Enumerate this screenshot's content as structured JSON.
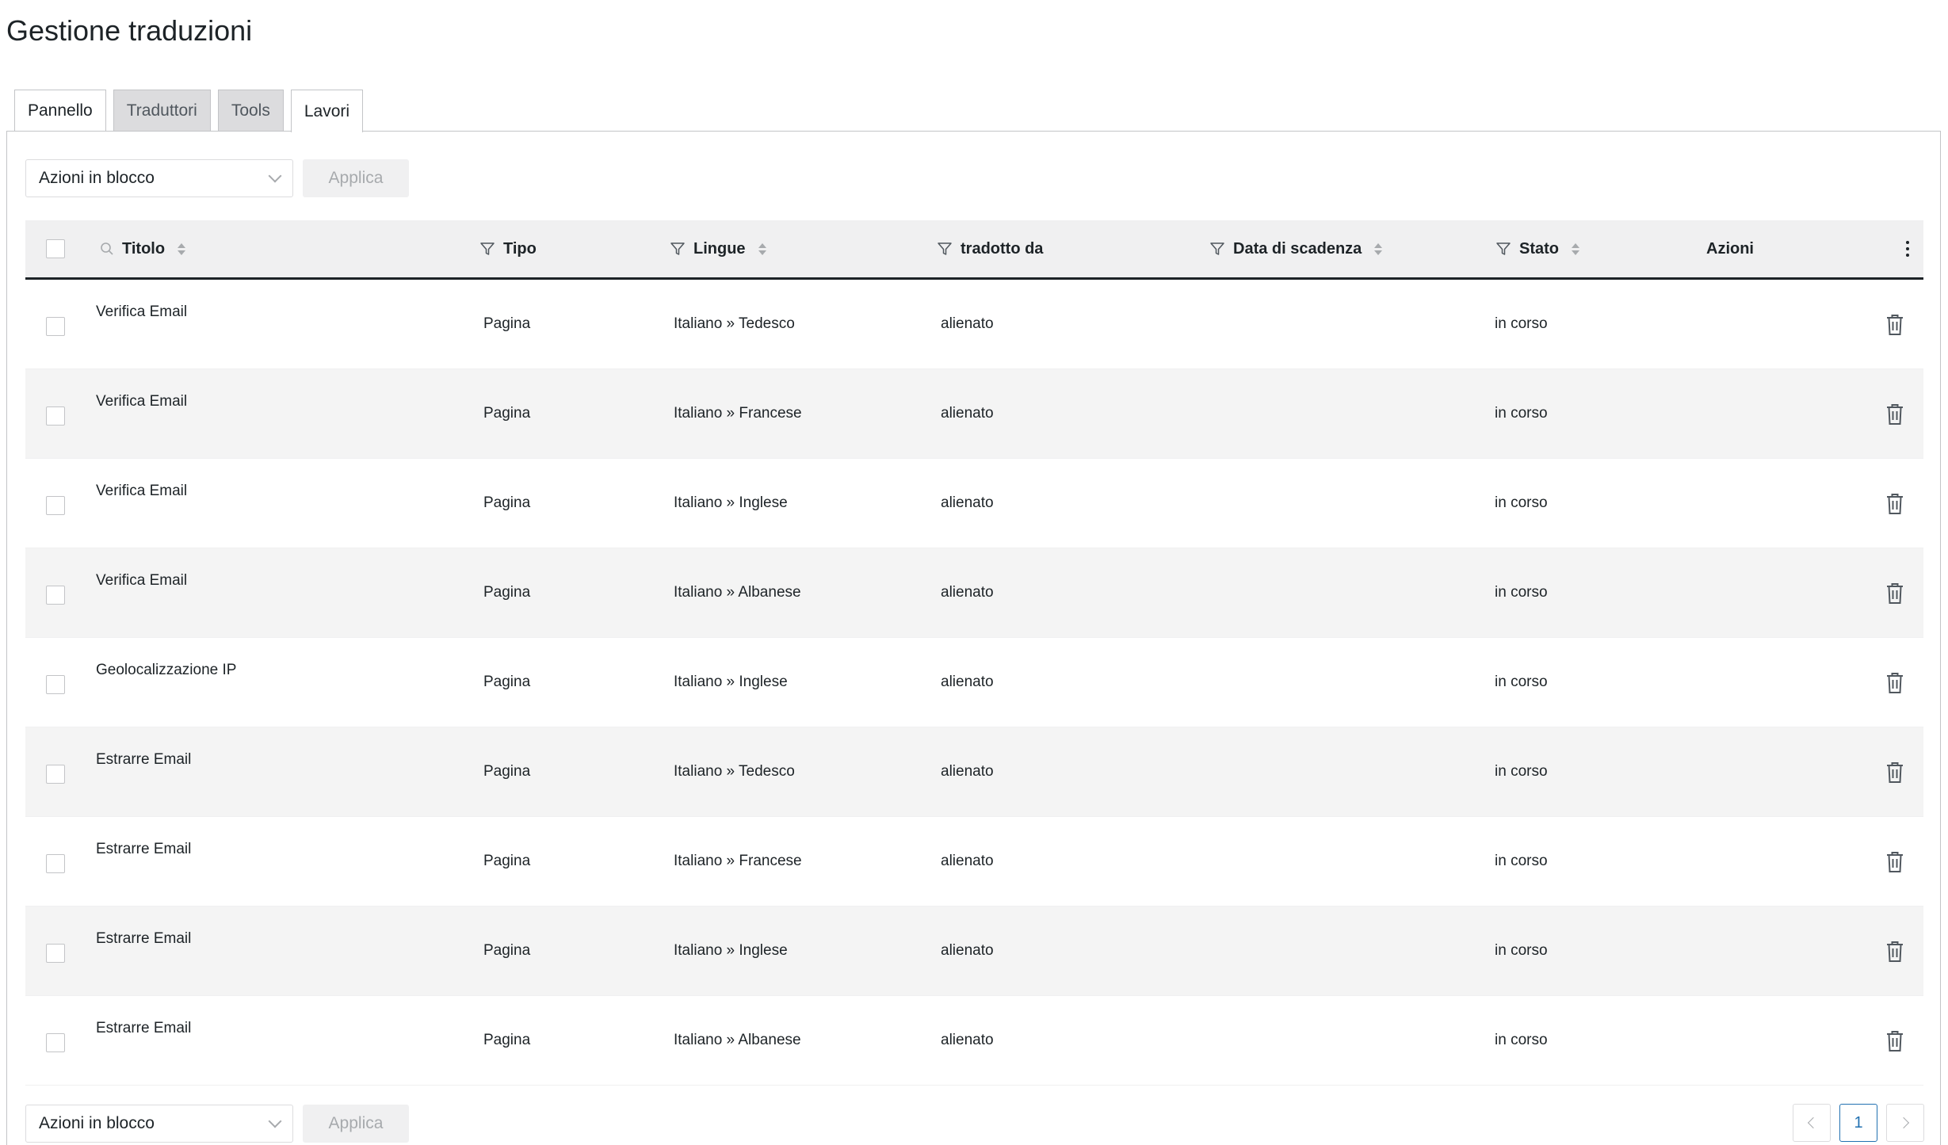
{
  "page": {
    "title": "Gestione traduzioni"
  },
  "tabs": [
    {
      "label": "Pannello",
      "state": "normal"
    },
    {
      "label": "Traduttori",
      "state": "inactive"
    },
    {
      "label": "Tools",
      "state": "inactive"
    },
    {
      "label": "Lavori",
      "state": "active"
    }
  ],
  "bulk_top": {
    "select_label": "Azioni in blocco",
    "apply_label": "Applica"
  },
  "bulk_bottom": {
    "select_label": "Azioni in blocco",
    "apply_label": "Applica"
  },
  "table": {
    "columns": {
      "title": "Titolo",
      "type": "Tipo",
      "languages": "Lingue",
      "translated_by": "tradotto da",
      "due_date": "Data di scadenza",
      "status": "Stato",
      "actions": "Azioni"
    },
    "rows": [
      {
        "title": "Verifica Email",
        "type": "Pagina",
        "languages": "Italiano » Tedesco",
        "translated_by": "alienato",
        "due_date": "",
        "status": "in corso"
      },
      {
        "title": "Verifica Email",
        "type": "Pagina",
        "languages": "Italiano » Francese",
        "translated_by": "alienato",
        "due_date": "",
        "status": "in corso"
      },
      {
        "title": "Verifica Email",
        "type": "Pagina",
        "languages": "Italiano » Inglese",
        "translated_by": "alienato",
        "due_date": "",
        "status": "in corso"
      },
      {
        "title": "Verifica Email",
        "type": "Pagina",
        "languages": "Italiano » Albanese",
        "translated_by": "alienato",
        "due_date": "",
        "status": "in corso"
      },
      {
        "title": "Geolocalizzazione IP",
        "type": "Pagina",
        "languages": "Italiano » Inglese",
        "translated_by": "alienato",
        "due_date": "",
        "status": "in corso"
      },
      {
        "title": "Estrarre Email",
        "type": "Pagina",
        "languages": "Italiano » Tedesco",
        "translated_by": "alienato",
        "due_date": "",
        "status": "in corso"
      },
      {
        "title": "Estrarre Email",
        "type": "Pagina",
        "languages": "Italiano » Francese",
        "translated_by": "alienato",
        "due_date": "",
        "status": "in corso"
      },
      {
        "title": "Estrarre Email",
        "type": "Pagina",
        "languages": "Italiano » Inglese",
        "translated_by": "alienato",
        "due_date": "",
        "status": "in corso"
      },
      {
        "title": "Estrarre Email",
        "type": "Pagina",
        "languages": "Italiano » Albanese",
        "translated_by": "alienato",
        "due_date": "",
        "status": "in corso"
      }
    ]
  },
  "pagination": {
    "current_page": "1"
  },
  "icons": {
    "row_action": "trash-icon",
    "column_menu": "kebab-menu-icon",
    "filter": "filter-icon",
    "search": "search-icon"
  }
}
